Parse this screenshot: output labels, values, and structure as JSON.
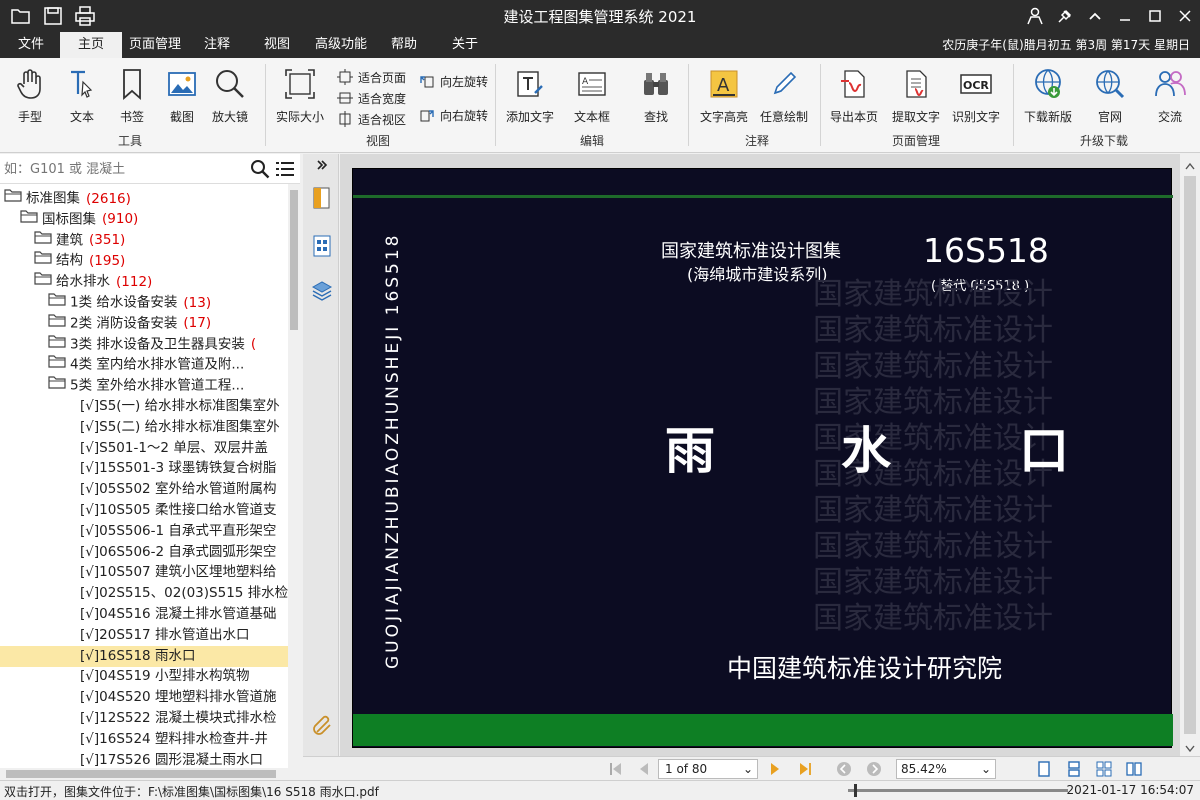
{
  "app": {
    "title": "建设工程图集管理系统 2021"
  },
  "menu": {
    "items": [
      "文件",
      "主页",
      "页面管理",
      "注释",
      "视图",
      "高级功能",
      "帮助",
      "关于"
    ],
    "active": "主页",
    "date": "农历庚子年(鼠)腊月初五 第3周 第17天 星期日"
  },
  "ribbon": {
    "tools": {
      "hand": "手型",
      "text": "文本",
      "bookmark": "书签",
      "screenshot": "截图",
      "magnifier": "放大镜",
      "group": "工具"
    },
    "view": {
      "actual": "实际大小",
      "fit_page": "适合页面",
      "fit_width": "适合宽度",
      "fit_view": "适合视区",
      "rot_left": "向左旋转",
      "rot_right": "向右旋转",
      "group": "视图"
    },
    "edit": {
      "add_text": "添加文字",
      "textbox": "文本框",
      "find": "查找",
      "group": "编辑"
    },
    "annot": {
      "highlight": "文字高亮",
      "draw": "任意绘制",
      "group": "注释"
    },
    "pagemgmt": {
      "export": "导出本页",
      "extract": "提取文字",
      "ocr": "识别文字",
      "group": "页面管理"
    },
    "upgrade": {
      "download": "下载新版",
      "website": "官网",
      "exchange": "交流",
      "group": "升级下载"
    }
  },
  "search": {
    "placeholder": "如：G101 或 混凝土"
  },
  "tree": [
    {
      "label": "标准图集",
      "count": "(2616)"
    },
    {
      "label": "国标图集",
      "count": "(910)"
    },
    {
      "label": "建筑",
      "count": "(351)"
    },
    {
      "label": "结构",
      "count": "(195)"
    },
    {
      "label": "给水排水",
      "count": "(112)"
    },
    {
      "label": "1类 给水设备安装",
      "count": "(13)"
    },
    {
      "label": "2类 消防设备安装",
      "count": "(17)"
    },
    {
      "label": "3类 排水设备及卫生器具安装",
      "count": "(",
      "clip": true
    },
    {
      "label": "4类 室内给水排水管道及附...",
      "count": ""
    },
    {
      "label": "5类 室外给水排水管道工程...",
      "count": ""
    },
    {
      "label": "[√]S5(一) 给水排水标准图集室外",
      "count": ""
    },
    {
      "label": "[√]S5(二) 给水排水标准图集室外",
      "count": ""
    },
    {
      "label": "[√]S501-1～2 单层、双层井盖",
      "count": ""
    },
    {
      "label": "[√]15S501-3 球墨铸铁复合树脂",
      "count": ""
    },
    {
      "label": "[√]05S502 室外给水管道附属构",
      "count": ""
    },
    {
      "label": "[√]10S505 柔性接口给水管道支",
      "count": ""
    },
    {
      "label": "[√]05S506-1 自承式平直形架空",
      "count": ""
    },
    {
      "label": "[√]06S506-2 自承式圆弧形架空",
      "count": ""
    },
    {
      "label": "[√]10S507 建筑小区埋地塑料给",
      "count": ""
    },
    {
      "label": "[√]02S515、02(03)S515 排水检",
      "count": ""
    },
    {
      "label": "[√]04S516 混凝土排水管道基础",
      "count": ""
    },
    {
      "label": "[√]20S517 排水管道出水口",
      "count": ""
    },
    {
      "label": "[√]16S518 雨水口",
      "count": "",
      "selected": true
    },
    {
      "label": "[√]04S519 小型排水构筑物",
      "count": ""
    },
    {
      "label": "[√]04S520 埋地塑料排水管道施",
      "count": ""
    },
    {
      "label": "[√]12S522 混凝土模块式排水检",
      "count": ""
    },
    {
      "label": "[√]16S524 塑料排水检查井-井",
      "count": ""
    },
    {
      "label": "[√]17S526 圆形混凝土雨水口",
      "count": ""
    }
  ],
  "doc": {
    "vertical": "GUOJIAJIANZHUBIAOZHUNSHEJI   16S518",
    "title1": "国家建筑标准设计图集",
    "title2": "(海绵城市建设系列)",
    "code": "16S518",
    "replace": "( 替代  05S518 )",
    "watermark": "国家建筑标准设计",
    "ch1": "雨",
    "ch2": "水",
    "ch3": "口",
    "institute": "中国建筑标准设计研究院"
  },
  "nav": {
    "page": "1 of 80",
    "zoom": "85.42%"
  },
  "status": {
    "text": "双击打开，图集文件位于：F:\\标准图集\\国标图集\\16 S518 雨水口.pdf",
    "time": "2021-01-17 16:54:07"
  },
  "colors": {
    "count": "#dd0000",
    "selected": "#fbe8a6",
    "page_bg": "#0c0c22",
    "green": "#0e7f24"
  }
}
